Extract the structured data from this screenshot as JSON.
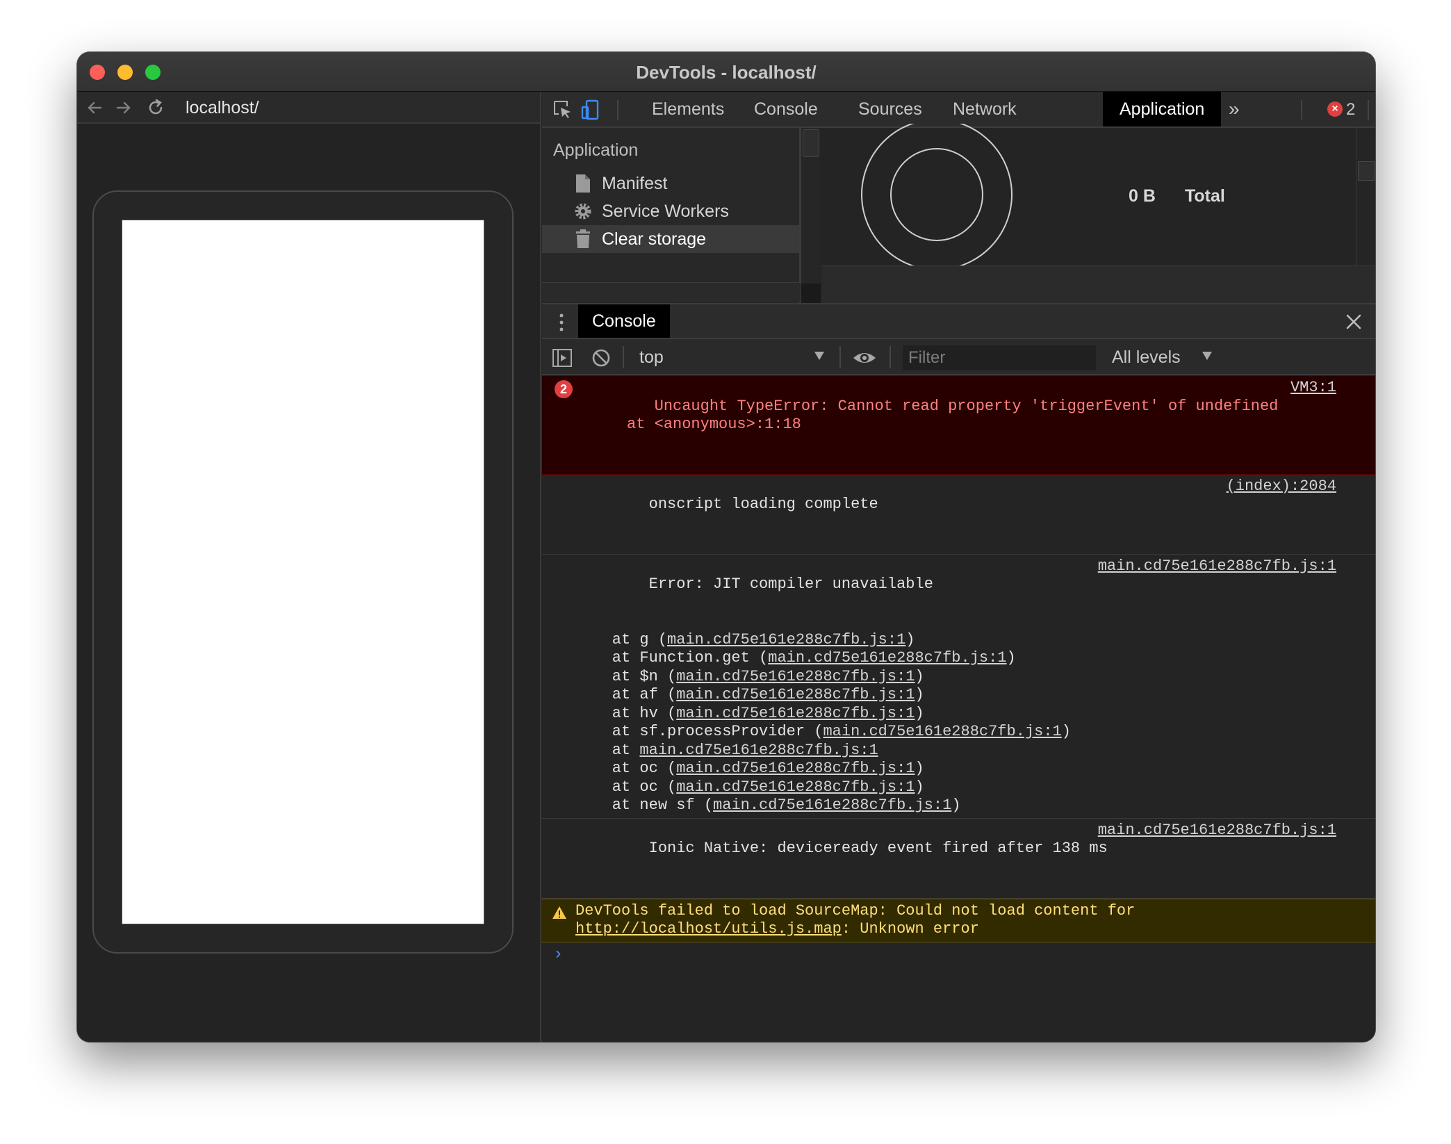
{
  "window": {
    "title": "DevTools - localhost/"
  },
  "browser": {
    "url": "localhost/",
    "icons": {
      "back": "arrow-left-icon",
      "forward": "arrow-right-icon",
      "reload": "reload-icon"
    }
  },
  "devtools": {
    "tabs": [
      {
        "label": "Elements"
      },
      {
        "label": "Console"
      },
      {
        "label": "Sources"
      },
      {
        "label": "Network"
      },
      {
        "label": "Application",
        "active": true
      }
    ],
    "more_tabs": "»",
    "error_count": "2",
    "icons": {
      "inspect": "inspect-element-icon",
      "device": "device-toolbar-icon",
      "settings": "gear-icon",
      "menu": "kebab-menu-icon"
    }
  },
  "application": {
    "sidebar_title": "Application",
    "items": [
      {
        "label": "Manifest",
        "icon": "file-icon"
      },
      {
        "label": "Service Workers",
        "icon": "gear-icon"
      },
      {
        "label": "Clear storage",
        "icon": "trash-icon",
        "selected": true
      }
    ],
    "storage": {
      "value": "0 B",
      "label": "Total"
    }
  },
  "drawer": {
    "tab": "Console"
  },
  "console_toolbar": {
    "context": "top",
    "filter_placeholder": "Filter",
    "levels": "All levels"
  },
  "messages": {
    "error": {
      "count": "2",
      "text": "Uncaught TypeError: Cannot read property 'triggerEvent' of undefined\n     at <anonymous>:1:18",
      "source": "VM3:1"
    },
    "log1": {
      "text": "onscript loading complete",
      "source": "(index):2084"
    },
    "jit": {
      "first": "Error: JIT compiler unavailable",
      "source": "main.cd75e161e288c7fb.js:1",
      "link": "main.cd75e161e288c7fb.js:1",
      "frames": [
        {
          "pre": "    at g (",
          "post": ")"
        },
        {
          "pre": "    at Function.get (",
          "post": ")"
        },
        {
          "pre": "    at $n (",
          "post": ")"
        },
        {
          "pre": "    at af (",
          "post": ")"
        },
        {
          "pre": "    at hv (",
          "post": ")"
        },
        {
          "pre": "    at sf.processProvider (",
          "post": ")"
        },
        {
          "pre": "    at ",
          "post": ""
        },
        {
          "pre": "    at oc (",
          "post": ")"
        },
        {
          "pre": "    at oc (",
          "post": ")"
        },
        {
          "pre": "    at new sf (",
          "post": ")"
        }
      ]
    },
    "ionic": {
      "text": "Ionic Native: deviceready event fired after 138 ms",
      "source": "main.cd75e161e288c7fb.js:1"
    },
    "warning": {
      "pre": "DevTools failed to load SourceMap: Could not load content for ",
      "link": "http://localhost/utils.js.map",
      "post": ": Unknown error"
    },
    "prompt": "›"
  }
}
